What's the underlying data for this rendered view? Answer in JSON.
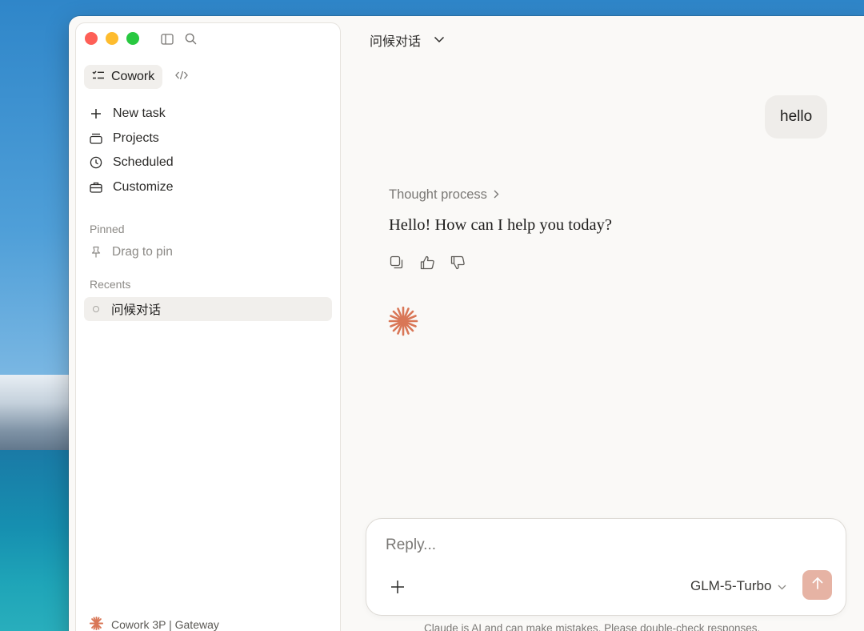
{
  "sidebar": {
    "mode_label": "Cowork",
    "nav_items": [
      {
        "label": "New task",
        "icon": "plus-icon"
      },
      {
        "label": "Projects",
        "icon": "projects-icon"
      },
      {
        "label": "Scheduled",
        "icon": "clock-icon"
      },
      {
        "label": "Customize",
        "icon": "briefcase-icon"
      }
    ],
    "pinned_label": "Pinned",
    "drag_to_pin": "Drag to pin",
    "recents_label": "Recents",
    "recents": [
      {
        "title": "问候对话"
      }
    ],
    "footer_label": "Cowork 3P | Gateway"
  },
  "main": {
    "conversation_title": "问候对话",
    "user_message": "hello",
    "thought_process_label": "Thought process",
    "assistant_message": "Hello! How can I help you today?"
  },
  "composer": {
    "placeholder": "Reply...",
    "model": "GLM-5-Turbo"
  },
  "disclaimer": "Claude is AI and can make mistakes. Please double-check responses.",
  "colors": {
    "accent": "#d97757",
    "send_button": "#e6b3a4",
    "close": "#fe5f57",
    "minimize": "#febc2e",
    "maximize": "#28c840"
  }
}
